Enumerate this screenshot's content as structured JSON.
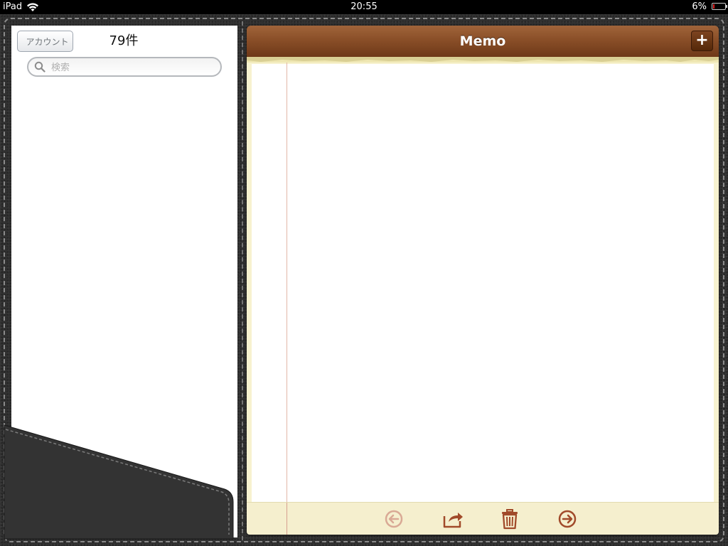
{
  "status_bar": {
    "device": "iPad",
    "time": "20:55",
    "battery_percent": "6%"
  },
  "left_panel": {
    "back_button_label": "アカウント",
    "count_title": "79件",
    "search_placeholder": "検索",
    "search_value": ""
  },
  "memo": {
    "title": "Memo",
    "add_button_label": "+",
    "body_text": ""
  },
  "toolbar": {
    "icons": [
      "previous-icon",
      "share-icon",
      "trash-icon",
      "next-icon"
    ],
    "previous_enabled": false
  },
  "colors": {
    "title_bar": "#8a4f28",
    "toolbar_icon": "#a14a2a",
    "toolbar_icon_disabled": "#d9a995",
    "paper": "#f7f2cf"
  }
}
